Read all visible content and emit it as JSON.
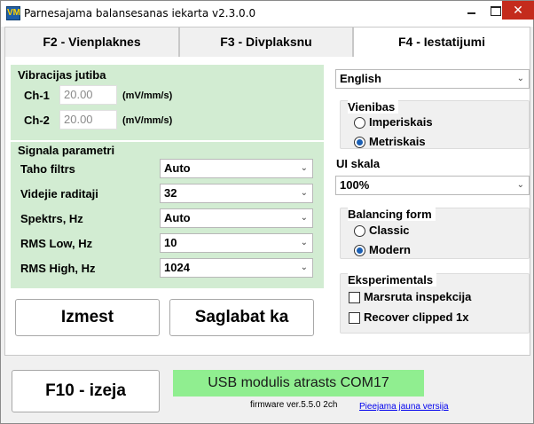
{
  "window": {
    "title": "Parnesajama balansesanas iekarta v2.3.0.0",
    "icon_text": "VM",
    "close_glyph": "✕"
  },
  "tabs": [
    {
      "label": "F2 - Vienplaknes"
    },
    {
      "label": "F3 - Divplaksnu"
    },
    {
      "label": "F4 - Iestatijumi"
    }
  ],
  "vibration": {
    "title": "Vibracijas jutiba",
    "ch1_label": "Ch-1",
    "ch1_value": "20.00",
    "ch2_label": "Ch-2",
    "ch2_value": "20.00",
    "unit": "(mV/mm/s)"
  },
  "signal": {
    "title": "Signala parametri",
    "rows": [
      {
        "label": "Taho filtrs",
        "value": "Auto"
      },
      {
        "label": "Videjie raditaji",
        "value": "32"
      },
      {
        "label": "Spektrs, Hz",
        "value": "Auto"
      },
      {
        "label": "RMS Low, Hz",
        "value": "10"
      },
      {
        "label": "RMS High, Hz",
        "value": "1024"
      }
    ]
  },
  "buttons": {
    "reset": "Izmest",
    "save": "Saglabat ka",
    "exit": "F10 - izeja"
  },
  "settings": {
    "language": "English",
    "units_title": "Vienibas",
    "units_options": [
      "Imperiskais",
      "Metriskais"
    ],
    "units_selected": 1,
    "ui_scale_title": "UI skala",
    "ui_scale_value": "100%",
    "balancing_title": "Balancing form",
    "balancing_options": [
      "Classic",
      "Modern"
    ],
    "balancing_selected": 1,
    "experimental_title": "Eksperimentals",
    "experimental_options": [
      {
        "label": "Marsruta inspekcija",
        "checked": false
      },
      {
        "label": "Recover clipped 1x",
        "checked": false
      }
    ]
  },
  "footer": {
    "status": "USB modulis atrasts COM17",
    "firmware": "firmware ver.5.5.0 2ch",
    "update_link": "Pieejama jauna versija"
  },
  "colors": {
    "group_green": "#d2ecd2",
    "status_green": "#90ee90",
    "radio_blue": "#1a5fb4",
    "close_red": "#c42b1c"
  }
}
